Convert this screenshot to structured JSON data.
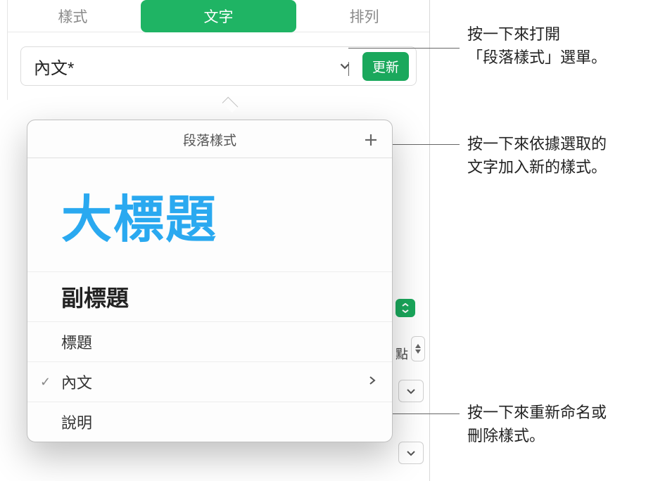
{
  "tabs": {
    "style": "樣式",
    "text": "文字",
    "arrange": "排列"
  },
  "styleRow": {
    "name": "內文*",
    "updateLabel": "更新"
  },
  "popup": {
    "title": "段落樣式",
    "items": {
      "bigTitle": "大標題",
      "subtitle": "副標題",
      "heading": "標題",
      "body": "內文",
      "caption": "說明"
    }
  },
  "bgLabels": {
    "point": "點"
  },
  "annotations": {
    "openMenu1": "按一下來打開",
    "openMenu2": "「段落樣式」選單。",
    "addStyle1": "按一下來依據選取的",
    "addStyle2": "文字加入新的樣式。",
    "rename1": "按一下來重新命名或",
    "rename2": "刪除樣式。"
  }
}
